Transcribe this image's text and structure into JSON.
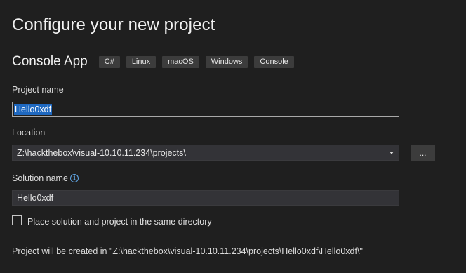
{
  "page": {
    "title": "Configure your new project"
  },
  "template": {
    "name": "Console App",
    "tags": [
      "C#",
      "Linux",
      "macOS",
      "Windows",
      "Console"
    ]
  },
  "project_name": {
    "label": "Project name",
    "value": "Hello0xdf"
  },
  "location": {
    "label": "Location",
    "value": "Z:\\hackthebox\\visual-10.10.11.234\\projects\\",
    "browse_label": "..."
  },
  "solution_name": {
    "label": "Solution name",
    "value": "Hello0xdf",
    "info_icon": "info-icon"
  },
  "same_directory": {
    "label": "Place solution and project in the same directory",
    "checked": false
  },
  "path_note": "Project will be created in \"Z:\\hackthebox\\visual-10.10.11.234\\projects\\Hello0xdf\\Hello0xdf\\\"",
  "colors": {
    "background": "#1f1f1f",
    "selection": "#1e68c0",
    "info_accent": "#61a8e8",
    "tag_bg": "#3c3c3c"
  }
}
